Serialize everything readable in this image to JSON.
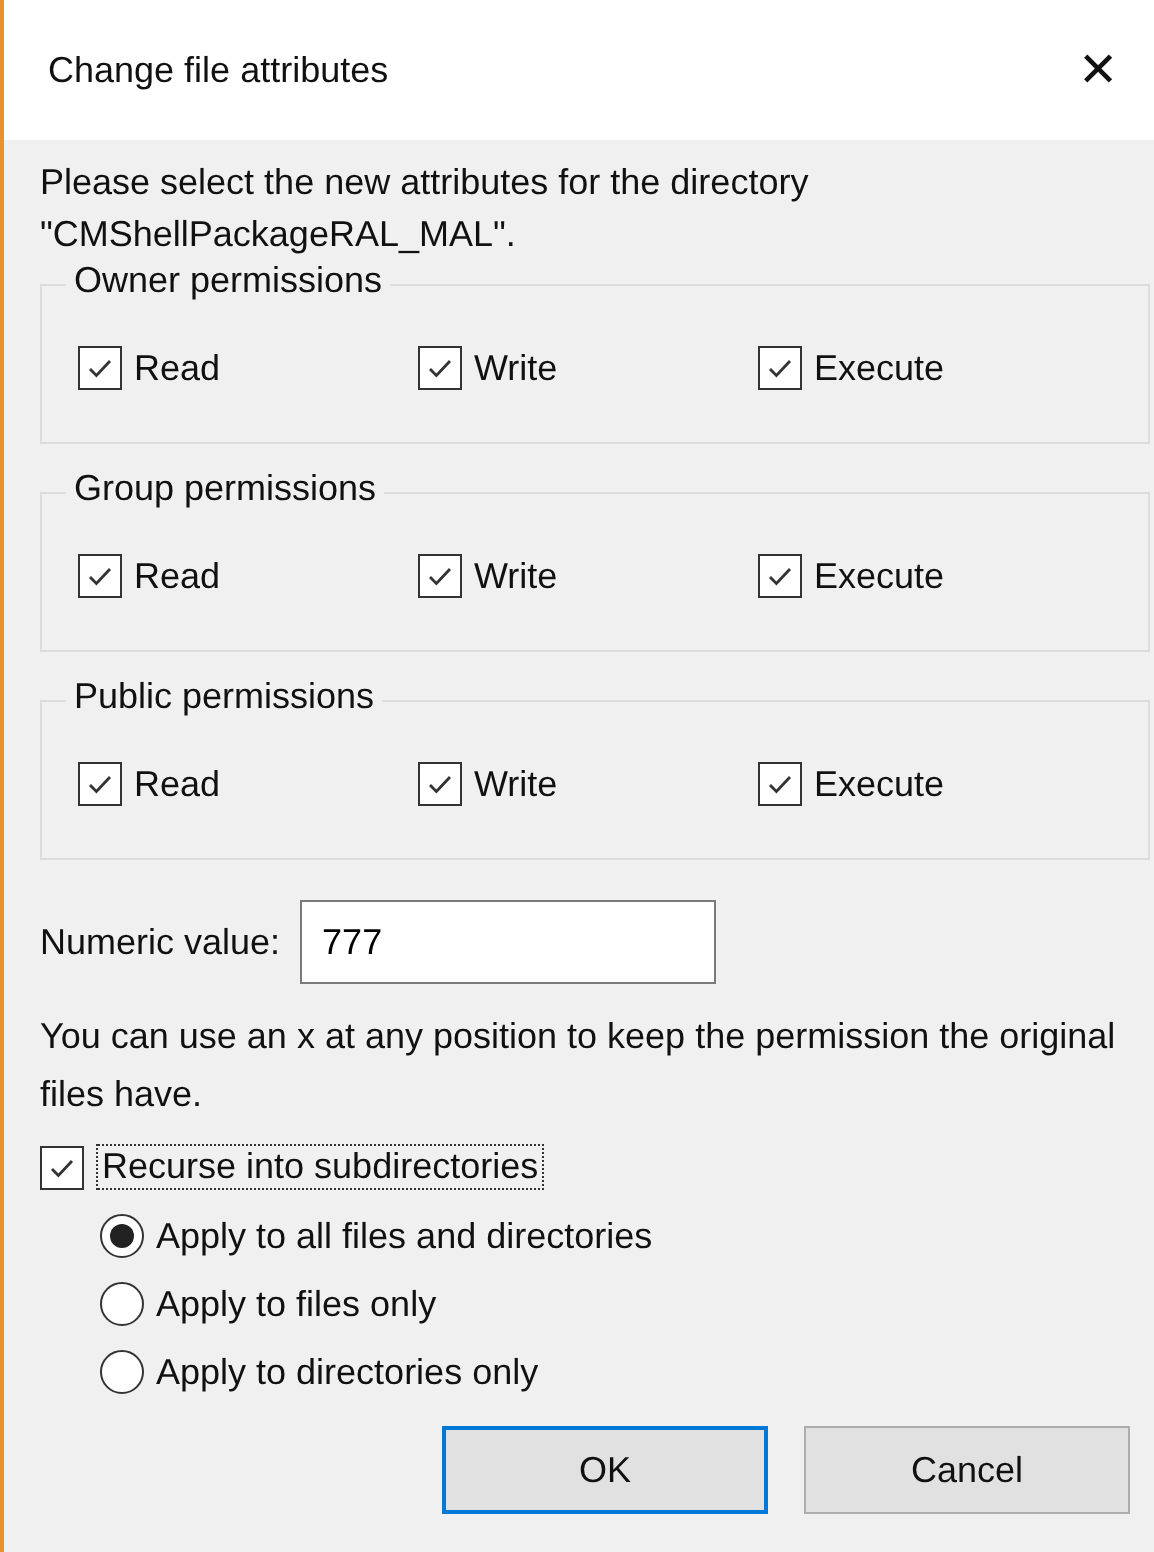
{
  "window": {
    "title": "Change file attributes",
    "close": "✕"
  },
  "description": "Please select the new attributes for the directory \"CMShellPackageRAL_MAL\".",
  "groups": [
    {
      "title": "Owner permissions",
      "options": [
        {
          "label": "Read",
          "checked": true
        },
        {
          "label": "Write",
          "checked": true
        },
        {
          "label": "Execute",
          "checked": true
        }
      ]
    },
    {
      "title": "Group permissions",
      "options": [
        {
          "label": "Read",
          "checked": true
        },
        {
          "label": "Write",
          "checked": true
        },
        {
          "label": "Execute",
          "checked": true
        }
      ]
    },
    {
      "title": "Public permissions",
      "options": [
        {
          "label": "Read",
          "checked": true
        },
        {
          "label": "Write",
          "checked": true
        },
        {
          "label": "Execute",
          "checked": true
        }
      ]
    }
  ],
  "numeric": {
    "label": "Numeric value:",
    "value": "777"
  },
  "note": "You can use an x at any position to keep the permission the original files have.",
  "recurse": {
    "label": "Recurse into subdirectories",
    "checked": true
  },
  "apply_options": [
    {
      "label": "Apply to all files and directories",
      "selected": true
    },
    {
      "label": "Apply to files only",
      "selected": false
    },
    {
      "label": "Apply to directories only",
      "selected": false
    }
  ],
  "buttons": [
    {
      "label": "OK",
      "default": true
    },
    {
      "label": "Cancel",
      "default": false
    }
  ]
}
